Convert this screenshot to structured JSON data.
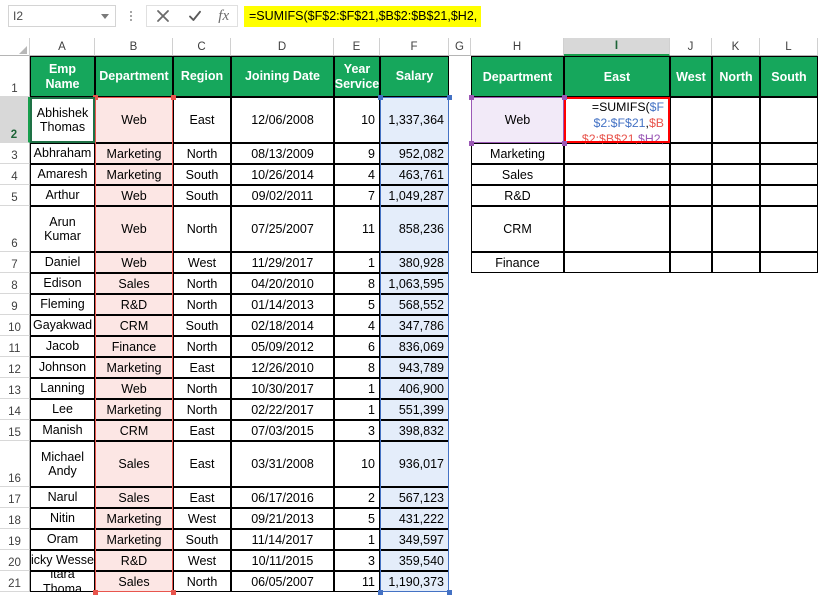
{
  "formula_bar": {
    "name_box_value": "I2",
    "formula": "=SUMIFS($F$2:$F$21,$B$2:$B$21,$H2,",
    "cancel_icon": "close-icon",
    "enter_icon": "check-icon",
    "function_icon": "fx-icon",
    "dropdown_icon": "chevron-down-icon",
    "more_icon": "kebab-menu-icon"
  },
  "grid": {
    "column_letters": [
      "A",
      "B",
      "C",
      "D",
      "E",
      "F",
      "G",
      "H",
      "I",
      "J",
      "K",
      "L"
    ],
    "selected_column": "I",
    "row_numbers": [
      "1",
      "2",
      "3",
      "4",
      "5",
      "6",
      "7",
      "8",
      "9",
      "10",
      "11",
      "12",
      "13",
      "14",
      "15",
      "16",
      "17",
      "18",
      "19",
      "20",
      "21"
    ],
    "selected_row": "2",
    "active_cell": "I2"
  },
  "left_table": {
    "headers": [
      "Emp Name",
      "Department",
      "Region",
      "Joining Date",
      "Year Service",
      "Salary"
    ],
    "rows": [
      {
        "name": "Abhishek Thomas",
        "dept": "Web",
        "region": "East",
        "date": "12/06/2008",
        "years": "10",
        "salary": "1,337,364"
      },
      {
        "name": "Abhraham",
        "dept": "Marketing",
        "region": "North",
        "date": "08/13/2009",
        "years": "9",
        "salary": "952,082"
      },
      {
        "name": "Amaresh",
        "dept": "Marketing",
        "region": "South",
        "date": "10/26/2014",
        "years": "4",
        "salary": "463,761"
      },
      {
        "name": "Arthur",
        "dept": "Web",
        "region": "South",
        "date": "09/02/2011",
        "years": "7",
        "salary": "1,049,287"
      },
      {
        "name": "Arun Kumar",
        "dept": "Web",
        "region": "North",
        "date": "07/25/2007",
        "years": "11",
        "salary": "858,236"
      },
      {
        "name": "Daniel",
        "dept": "Web",
        "region": "West",
        "date": "11/29/2017",
        "years": "1",
        "salary": "380,928"
      },
      {
        "name": "Edison",
        "dept": "Sales",
        "region": "North",
        "date": "04/20/2010",
        "years": "8",
        "salary": "1,063,595"
      },
      {
        "name": "Fleming",
        "dept": "R&D",
        "region": "North",
        "date": "01/14/2013",
        "years": "5",
        "salary": "568,552"
      },
      {
        "name": "Gayakwad",
        "dept": "CRM",
        "region": "South",
        "date": "02/18/2014",
        "years": "4",
        "salary": "347,786"
      },
      {
        "name": "Jacob",
        "dept": "Finance",
        "region": "North",
        "date": "05/09/2012",
        "years": "6",
        "salary": "836,069"
      },
      {
        "name": "Johnson",
        "dept": "Marketing",
        "region": "East",
        "date": "12/26/2010",
        "years": "8",
        "salary": "943,789"
      },
      {
        "name": "Lanning",
        "dept": "Web",
        "region": "North",
        "date": "10/30/2017",
        "years": "1",
        "salary": "406,900"
      },
      {
        "name": "Lee",
        "dept": "Marketing",
        "region": "North",
        "date": "02/22/2017",
        "years": "1",
        "salary": "551,399"
      },
      {
        "name": "Manish",
        "dept": "CRM",
        "region": "East",
        "date": "07/03/2015",
        "years": "3",
        "salary": "398,832"
      },
      {
        "name": "Michael Andy",
        "dept": "Sales",
        "region": "East",
        "date": "03/31/2008",
        "years": "10",
        "salary": "936,017"
      },
      {
        "name": "Narul",
        "dept": "Sales",
        "region": "East",
        "date": "06/17/2016",
        "years": "2",
        "salary": "567,123"
      },
      {
        "name": "Nitin",
        "dept": "Marketing",
        "region": "West",
        "date": "09/21/2013",
        "years": "5",
        "salary": "431,222"
      },
      {
        "name": "Oram",
        "dept": "Marketing",
        "region": "South",
        "date": "11/14/2017",
        "years": "1",
        "salary": "349,597"
      },
      {
        "name": "icky Wesse",
        "dept": "R&D",
        "region": "West",
        "date": "10/11/2015",
        "years": "3",
        "salary": "359,540"
      },
      {
        "name": "itara Thoma",
        "dept": "Sales",
        "region": "North",
        "date": "06/05/2007",
        "years": "11",
        "salary": "1,190,373"
      }
    ]
  },
  "right_table": {
    "headers": [
      "Department",
      "East",
      "West",
      "North",
      "South"
    ],
    "departments": [
      "Web",
      "Marketing",
      "Sales",
      "R&D",
      "CRM",
      "Finance"
    ],
    "formula_cell": {
      "address": "I2",
      "tokens": [
        {
          "t": "=SUMIFS(",
          "c": "plain"
        },
        {
          "t": "$F$2:",
          "c": "f"
        },
        {
          "t": "$F$21",
          "c": "f"
        },
        {
          "t": ",",
          "c": "plain"
        },
        {
          "t": "$B$2:",
          "c": "b"
        },
        {
          "t": "$B$21",
          "c": "b"
        },
        {
          "t": ",",
          "c": "b"
        },
        {
          "t": "$H2",
          "c": "h"
        },
        {
          "t": ",",
          "c": "h"
        }
      ]
    }
  },
  "colors": {
    "header_green": "#16A75C",
    "formula_highlight": "#FFFF00",
    "ref_salary_blue": "#4472C4",
    "ref_dept_red": "#E8554D",
    "ref_criteria_purple": "#9B59B6",
    "active_border_red": "#FF0000",
    "fill_pink": "#FCE6E4",
    "fill_blue": "#E4EDFA",
    "fill_lavender": "#F2EAF8"
  }
}
